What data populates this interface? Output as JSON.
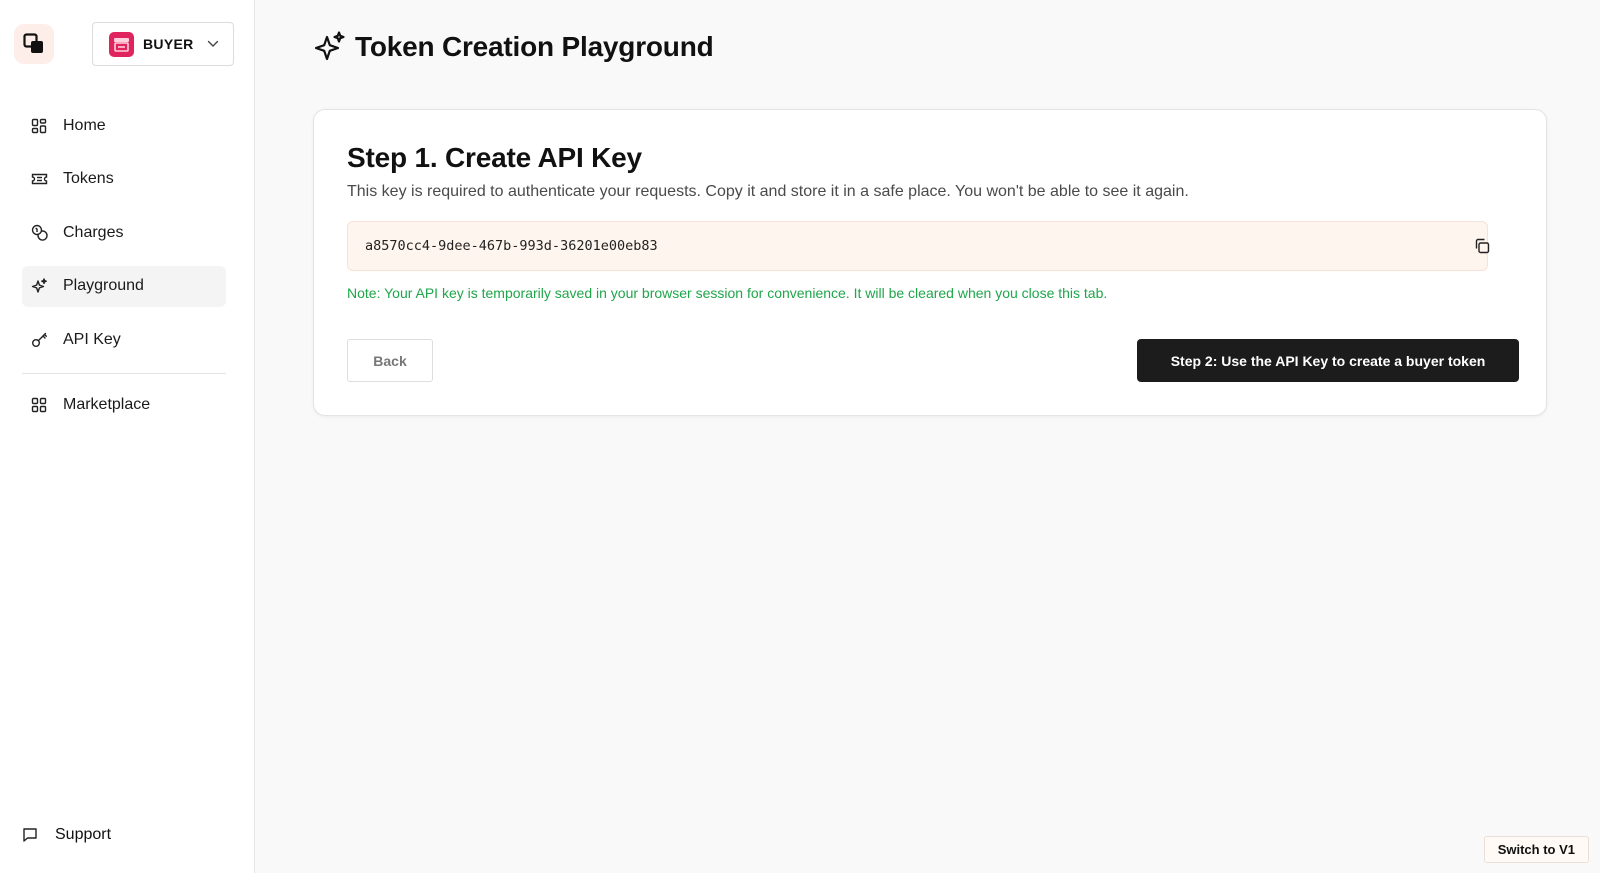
{
  "sidebar": {
    "role_selector": {
      "label": "BUYER",
      "avatar_color": "#e0245e"
    },
    "items": [
      {
        "label": "Home",
        "icon": "grid-icon"
      },
      {
        "label": "Tokens",
        "icon": "ticket-icon"
      },
      {
        "label": "Charges",
        "icon": "coins-icon"
      },
      {
        "label": "Playground",
        "icon": "sparkles-icon",
        "active": true
      },
      {
        "label": "API Key",
        "icon": "key-icon"
      },
      {
        "label": "Marketplace",
        "icon": "grid-icon"
      }
    ],
    "support_label": "Support"
  },
  "header": {
    "title": "Token Creation Playground",
    "icon": "sparkles-icon"
  },
  "card": {
    "title": "Step 1. Create API Key",
    "description": "This key is required to authenticate your requests. Copy it and store it in a safe place. You won't be able to see it again.",
    "api_key": "a8570cc4-9dee-467b-993d-36201e00eb83",
    "note": "Note: Your API key is temporarily saved in your browser session for convenience. It will be cleared when you close this tab.",
    "back_label": "Back",
    "next_label": "Step 2: Use the API Key to create a buyer token"
  },
  "footer": {
    "switch_label": "Switch to V1"
  },
  "colors": {
    "accent": "#1c1c1c",
    "note": "#1fa64a",
    "key_bg": "#fef5ef",
    "brand": "#e0245e"
  }
}
